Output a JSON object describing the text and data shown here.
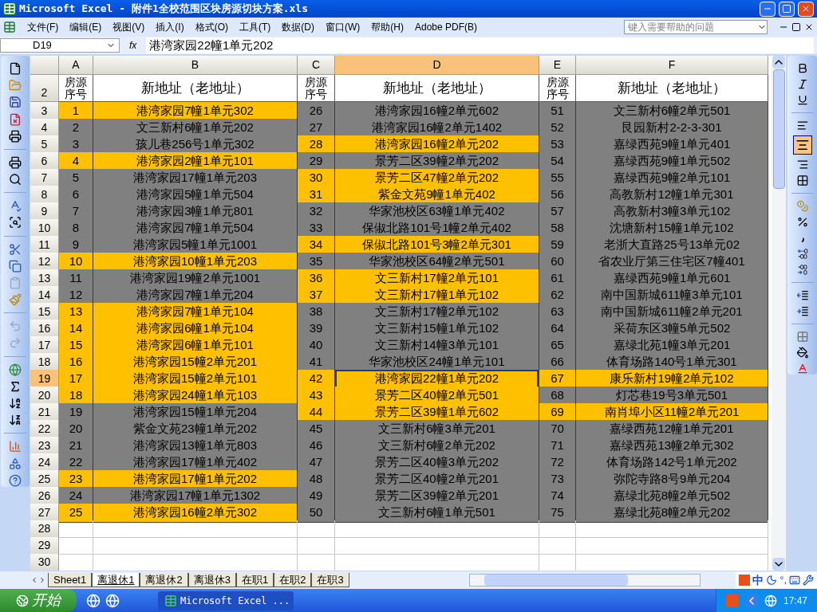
{
  "window": {
    "title": "Microsoft Excel - 附件1全校范围区块房源切块方案.xls"
  },
  "menu": [
    "文件(F)",
    "编辑(E)",
    "视图(V)",
    "插入(I)",
    "格式(O)",
    "工具(T)",
    "数据(D)",
    "窗口(W)",
    "帮助(H)",
    "Adobe PDF(B)"
  ],
  "help_search": {
    "placeholder": "键入需要帮助的问题"
  },
  "formula_bar": {
    "name_box": "D19",
    "function_label": "fx",
    "value": "港湾家园22幢1单元202"
  },
  "format_toolbar": {
    "center_align_active": true
  },
  "column_headers": [
    {
      "label": "A",
      "selected": false
    },
    {
      "label": "B",
      "selected": false
    },
    {
      "label": "C",
      "selected": false
    },
    {
      "label": "D",
      "selected": true
    },
    {
      "label": "E",
      "selected": false
    },
    {
      "label": "F",
      "selected": false
    }
  ],
  "header_row": {
    "row": "2",
    "cells": [
      "房源序号",
      "新地址（老地址）",
      "房源序号",
      "新地址（老地址）",
      "房源序号",
      "新地址（老地址）"
    ]
  },
  "rows": [
    {
      "row": "3",
      "selected": false,
      "pairs": [
        {
          "number": "1",
          "address": "港湾家园7幢1单元302",
          "highlighted": true,
          "selected": false
        },
        {
          "number": "26",
          "address": "港湾家园16幢2单元602",
          "highlighted": false,
          "selected": false
        },
        {
          "number": "51",
          "address": "文三新村6幢2单元501",
          "highlighted": false,
          "selected": false
        }
      ]
    },
    {
      "row": "4",
      "selected": false,
      "pairs": [
        {
          "number": "2",
          "address": "文三新村6幢1单元202",
          "highlighted": false,
          "selected": false
        },
        {
          "number": "27",
          "address": "港湾家园16幢2单元1402",
          "highlighted": false,
          "selected": false
        },
        {
          "number": "52",
          "address": "艮园新村2-2-3-301",
          "highlighted": false,
          "selected": false
        }
      ]
    },
    {
      "row": "5",
      "selected": false,
      "pairs": [
        {
          "number": "3",
          "address": "孩儿巷256号1单元302",
          "highlighted": false,
          "selected": false
        },
        {
          "number": "28",
          "address": "港湾家园16幢2单元202",
          "highlighted": true,
          "selected": false
        },
        {
          "number": "53",
          "address": "嘉绿西苑9幢1单元401",
          "highlighted": false,
          "selected": false
        }
      ]
    },
    {
      "row": "6",
      "selected": false,
      "pairs": [
        {
          "number": "4",
          "address": "港湾家园2幢1单元101",
          "highlighted": true,
          "selected": false
        },
        {
          "number": "29",
          "address": "景芳二区39幢2单元202",
          "highlighted": false,
          "selected": false
        },
        {
          "number": "54",
          "address": "嘉绿西苑9幢1单元502",
          "highlighted": false,
          "selected": false
        }
      ]
    },
    {
      "row": "7",
      "selected": false,
      "pairs": [
        {
          "number": "5",
          "address": "港湾家园17幢1单元203",
          "highlighted": false,
          "selected": false
        },
        {
          "number": "30",
          "address": "景芳二区47幢2单元202",
          "highlighted": true,
          "selected": false
        },
        {
          "number": "55",
          "address": "嘉绿西苑9幢2单元101",
          "highlighted": false,
          "selected": false
        }
      ]
    },
    {
      "row": "8",
      "selected": false,
      "pairs": [
        {
          "number": "6",
          "address": "港湾家园5幢1单元504",
          "highlighted": false,
          "selected": false
        },
        {
          "number": "31",
          "address": "紫金文苑9幢1单元402",
          "highlighted": true,
          "selected": false
        },
        {
          "number": "56",
          "address": "高教新村12幢1单元301",
          "highlighted": false,
          "selected": false
        }
      ]
    },
    {
      "row": "9",
      "selected": false,
      "pairs": [
        {
          "number": "7",
          "address": "港湾家园3幢1单元801",
          "highlighted": false,
          "selected": false
        },
        {
          "number": "32",
          "address": "华家池校区63幢1单元402",
          "highlighted": false,
          "selected": false
        },
        {
          "number": "57",
          "address": "高教新村3幢3单元102",
          "highlighted": false,
          "selected": false
        }
      ]
    },
    {
      "row": "10",
      "selected": false,
      "pairs": [
        {
          "number": "8",
          "address": "港湾家园7幢1单元504",
          "highlighted": false,
          "selected": false
        },
        {
          "number": "33",
          "address": "保俶北路101号1幢2单元402",
          "highlighted": false,
          "selected": false
        },
        {
          "number": "58",
          "address": "沈塘新村15幢1单元102",
          "highlighted": false,
          "selected": false
        }
      ]
    },
    {
      "row": "11",
      "selected": false,
      "pairs": [
        {
          "number": "9",
          "address": "港湾家园5幢1单元1001",
          "highlighted": false,
          "selected": false
        },
        {
          "number": "34",
          "address": "保俶北路101号3幢2单元301",
          "highlighted": true,
          "selected": false
        },
        {
          "number": "59",
          "address": "老浙大直路25号13单元02",
          "highlighted": false,
          "selected": false
        }
      ]
    },
    {
      "row": "12",
      "selected": false,
      "pairs": [
        {
          "number": "10",
          "address": "港湾家园10幢1单元203",
          "highlighted": true,
          "selected": false
        },
        {
          "number": "35",
          "address": "华家池校区64幢2单元501",
          "highlighted": false,
          "selected": false
        },
        {
          "number": "60",
          "address": "省农业厅第三住宅区7幢401",
          "highlighted": false,
          "selected": false
        }
      ]
    },
    {
      "row": "13",
      "selected": false,
      "pairs": [
        {
          "number": "11",
          "address": "港湾家园19幢2单元1001",
          "highlighted": false,
          "selected": false
        },
        {
          "number": "36",
          "address": "文三新村17幢2单元101",
          "highlighted": true,
          "selected": false
        },
        {
          "number": "61",
          "address": "嘉绿西苑9幢1单元601",
          "highlighted": false,
          "selected": false
        }
      ]
    },
    {
      "row": "14",
      "selected": false,
      "pairs": [
        {
          "number": "12",
          "address": "港湾家园7幢1单元204",
          "highlighted": false,
          "selected": false
        },
        {
          "number": "37",
          "address": "文三新村17幢1单元102",
          "highlighted": true,
          "selected": false
        },
        {
          "number": "62",
          "address": "南中国新城611幢3单元101",
          "highlighted": false,
          "selected": false
        }
      ]
    },
    {
      "row": "15",
      "selected": false,
      "pairs": [
        {
          "number": "13",
          "address": "港湾家园7幢1单元104",
          "highlighted": true,
          "selected": false
        },
        {
          "number": "38",
          "address": "文三新村17幢2单元102",
          "highlighted": false,
          "selected": false
        },
        {
          "number": "63",
          "address": "南中国新城611幢2单元201",
          "highlighted": false,
          "selected": false
        }
      ]
    },
    {
      "row": "16",
      "selected": false,
      "pairs": [
        {
          "number": "14",
          "address": "港湾家园6幢1单元104",
          "highlighted": true,
          "selected": false
        },
        {
          "number": "39",
          "address": "文三新村15幢1单元102",
          "highlighted": false,
          "selected": false
        },
        {
          "number": "64",
          "address": "采荷东区3幢5单元502",
          "highlighted": false,
          "selected": false
        }
      ]
    },
    {
      "row": "17",
      "selected": false,
      "pairs": [
        {
          "number": "15",
          "address": "港湾家园6幢1单元101",
          "highlighted": true,
          "selected": false
        },
        {
          "number": "40",
          "address": "文三新村14幢3单元101",
          "highlighted": false,
          "selected": false
        },
        {
          "number": "65",
          "address": "嘉绿北苑1幢3单元201",
          "highlighted": false,
          "selected": false
        }
      ]
    },
    {
      "row": "18",
      "selected": false,
      "pairs": [
        {
          "number": "16",
          "address": "港湾家园15幢2单元201",
          "highlighted": true,
          "selected": false
        },
        {
          "number": "41",
          "address": "华家池校区24幢1单元101",
          "highlighted": false,
          "selected": false
        },
        {
          "number": "66",
          "address": "体育场路140号1单元301",
          "highlighted": false,
          "selected": false
        }
      ]
    },
    {
      "row": "19",
      "selected": true,
      "pairs": [
        {
          "number": "17",
          "address": "港湾家园15幢2单元101",
          "highlighted": true,
          "selected": false
        },
        {
          "number": "42",
          "address": "港湾家园22幢1单元202",
          "highlighted": true,
          "selected": true
        },
        {
          "number": "67",
          "address": "康乐新村19幢2单元102",
          "highlighted": true,
          "selected": false
        }
      ]
    },
    {
      "row": "20",
      "selected": false,
      "pairs": [
        {
          "number": "18",
          "address": "港湾家园24幢1单元103",
          "highlighted": true,
          "selected": false
        },
        {
          "number": "43",
          "address": "景芳二区40幢2单元501",
          "highlighted": true,
          "selected": false
        },
        {
          "number": "68",
          "address": "灯芯巷19号3单元501",
          "highlighted": false,
          "selected": false
        }
      ]
    },
    {
      "row": "21",
      "selected": false,
      "pairs": [
        {
          "number": "19",
          "address": "港湾家园15幢1单元204",
          "highlighted": false,
          "selected": false
        },
        {
          "number": "44",
          "address": "景芳二区39幢1单元602",
          "highlighted": true,
          "selected": false
        },
        {
          "number": "69",
          "address": "南肖埠小区11幢2单元201",
          "highlighted": true,
          "selected": false
        }
      ]
    },
    {
      "row": "22",
      "selected": false,
      "pairs": [
        {
          "number": "20",
          "address": "紫金文苑23幢1单元202",
          "highlighted": false,
          "selected": false
        },
        {
          "number": "45",
          "address": "文三新村6幢3单元201",
          "highlighted": false,
          "selected": false
        },
        {
          "number": "70",
          "address": "嘉绿西苑12幢1单元201",
          "highlighted": false,
          "selected": false
        }
      ]
    },
    {
      "row": "23",
      "selected": false,
      "pairs": [
        {
          "number": "21",
          "address": "港湾家园13幢1单元803",
          "highlighted": false,
          "selected": false
        },
        {
          "number": "46",
          "address": "文三新村6幢2单元202",
          "highlighted": false,
          "selected": false
        },
        {
          "number": "71",
          "address": "嘉绿西苑13幢2单元302",
          "highlighted": false,
          "selected": false
        }
      ]
    },
    {
      "row": "24",
      "selected": false,
      "pairs": [
        {
          "number": "22",
          "address": "港湾家园17幢1单元402",
          "highlighted": false,
          "selected": false
        },
        {
          "number": "47",
          "address": "景芳二区40幢3单元202",
          "highlighted": false,
          "selected": false
        },
        {
          "number": "72",
          "address": "体育场路142号1单元202",
          "highlighted": false,
          "selected": false
        }
      ]
    },
    {
      "row": "25",
      "selected": false,
      "pairs": [
        {
          "number": "23",
          "address": "港湾家园17幢1单元202",
          "highlighted": true,
          "selected": false
        },
        {
          "number": "48",
          "address": "景芳二区40幢2单元201",
          "highlighted": false,
          "selected": false
        },
        {
          "number": "73",
          "address": "弥陀寺路8号9单元204",
          "highlighted": false,
          "selected": false
        }
      ]
    },
    {
      "row": "26",
      "selected": false,
      "pairs": [
        {
          "number": "24",
          "address": "港湾家园17幢1单元1302",
          "highlighted": false,
          "selected": false
        },
        {
          "number": "49",
          "address": "景芳二区39幢2单元201",
          "highlighted": false,
          "selected": false
        },
        {
          "number": "74",
          "address": "嘉绿北苑8幢2单元502",
          "highlighted": false,
          "selected": false
        }
      ]
    },
    {
      "row": "27",
      "selected": false,
      "pairs": [
        {
          "number": "25",
          "address": "港湾家园16幢2单元302",
          "highlighted": true,
          "selected": false
        },
        {
          "number": "50",
          "address": "文三新村6幢1单元501",
          "highlighted": false,
          "selected": false
        },
        {
          "number": "75",
          "address": "嘉绿北苑8幢2单元202",
          "highlighted": false,
          "selected": false
        }
      ]
    }
  ],
  "empty_rows": [
    "28",
    "29",
    "30"
  ],
  "sheet_tabs": [
    {
      "label": "Sheet1",
      "selected": false
    },
    {
      "label": "离退休1",
      "selected": true
    },
    {
      "label": "离退休2",
      "selected": false
    },
    {
      "label": "离退休3",
      "selected": false
    },
    {
      "label": "在职1",
      "selected": false
    },
    {
      "label": "在职2",
      "selected": false
    },
    {
      "label": "在职3",
      "selected": false
    }
  ],
  "ime": {
    "mode": "中",
    "punctuation": "°,"
  },
  "taskbar": {
    "start": "开始",
    "tasks": [
      "Microsoft Excel ..."
    ],
    "clock": "17:47"
  }
}
